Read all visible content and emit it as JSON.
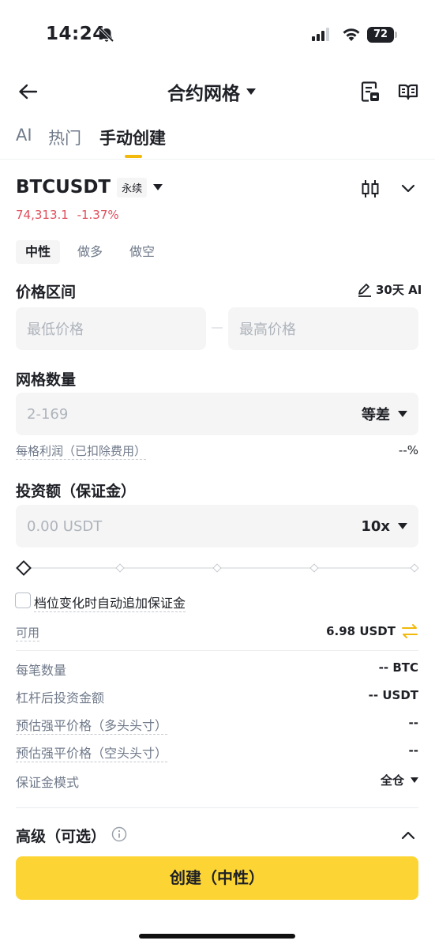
{
  "status_bar": {
    "time": "14:24",
    "battery": "72"
  },
  "header": {
    "title": "合约网格"
  },
  "tabs": [
    {
      "label": "AI",
      "active": false
    },
    {
      "label": "热门",
      "active": false
    },
    {
      "label": "手动创建",
      "active": true
    }
  ],
  "symbol": {
    "name": "BTCUSDT",
    "badge": "永续",
    "price": "74,313.1",
    "change": "-1.37%"
  },
  "direction_tabs": [
    "中性",
    "做多",
    "做空"
  ],
  "price_range": {
    "label": "价格区间",
    "ai_link": "30天 AI",
    "min_placeholder": "最低价格",
    "max_placeholder": "最高价格"
  },
  "grid_count": {
    "label": "网格数量",
    "placeholder": "2-169",
    "mode": "等差",
    "profit_label": "每格利润（已扣除费用）",
    "profit_value": "--%"
  },
  "investment": {
    "label": "投资额（保证金）",
    "placeholder": "0.00 USDT",
    "leverage": "10x"
  },
  "auto_margin_label": "档位变化时自动追加保证金",
  "available": {
    "label": "可用",
    "value": "6.98 USDT"
  },
  "info_rows": [
    {
      "label": "每笔数量",
      "value": "-- BTC"
    },
    {
      "label": "杠杆后投资金额",
      "value": "-- USDT"
    },
    {
      "label": "预估强平价格（多头头寸）",
      "value": "--"
    },
    {
      "label": "预估强平价格（空头头寸）",
      "value": "--"
    },
    {
      "label": "保证金模式",
      "value": "全仓"
    }
  ],
  "advanced": {
    "label": "高级（可选）"
  },
  "create_button": "创建（中性）",
  "colors": {
    "accent": "#fcd535",
    "tab_underline": "#f0b90b",
    "negative": "#e04e5b"
  }
}
